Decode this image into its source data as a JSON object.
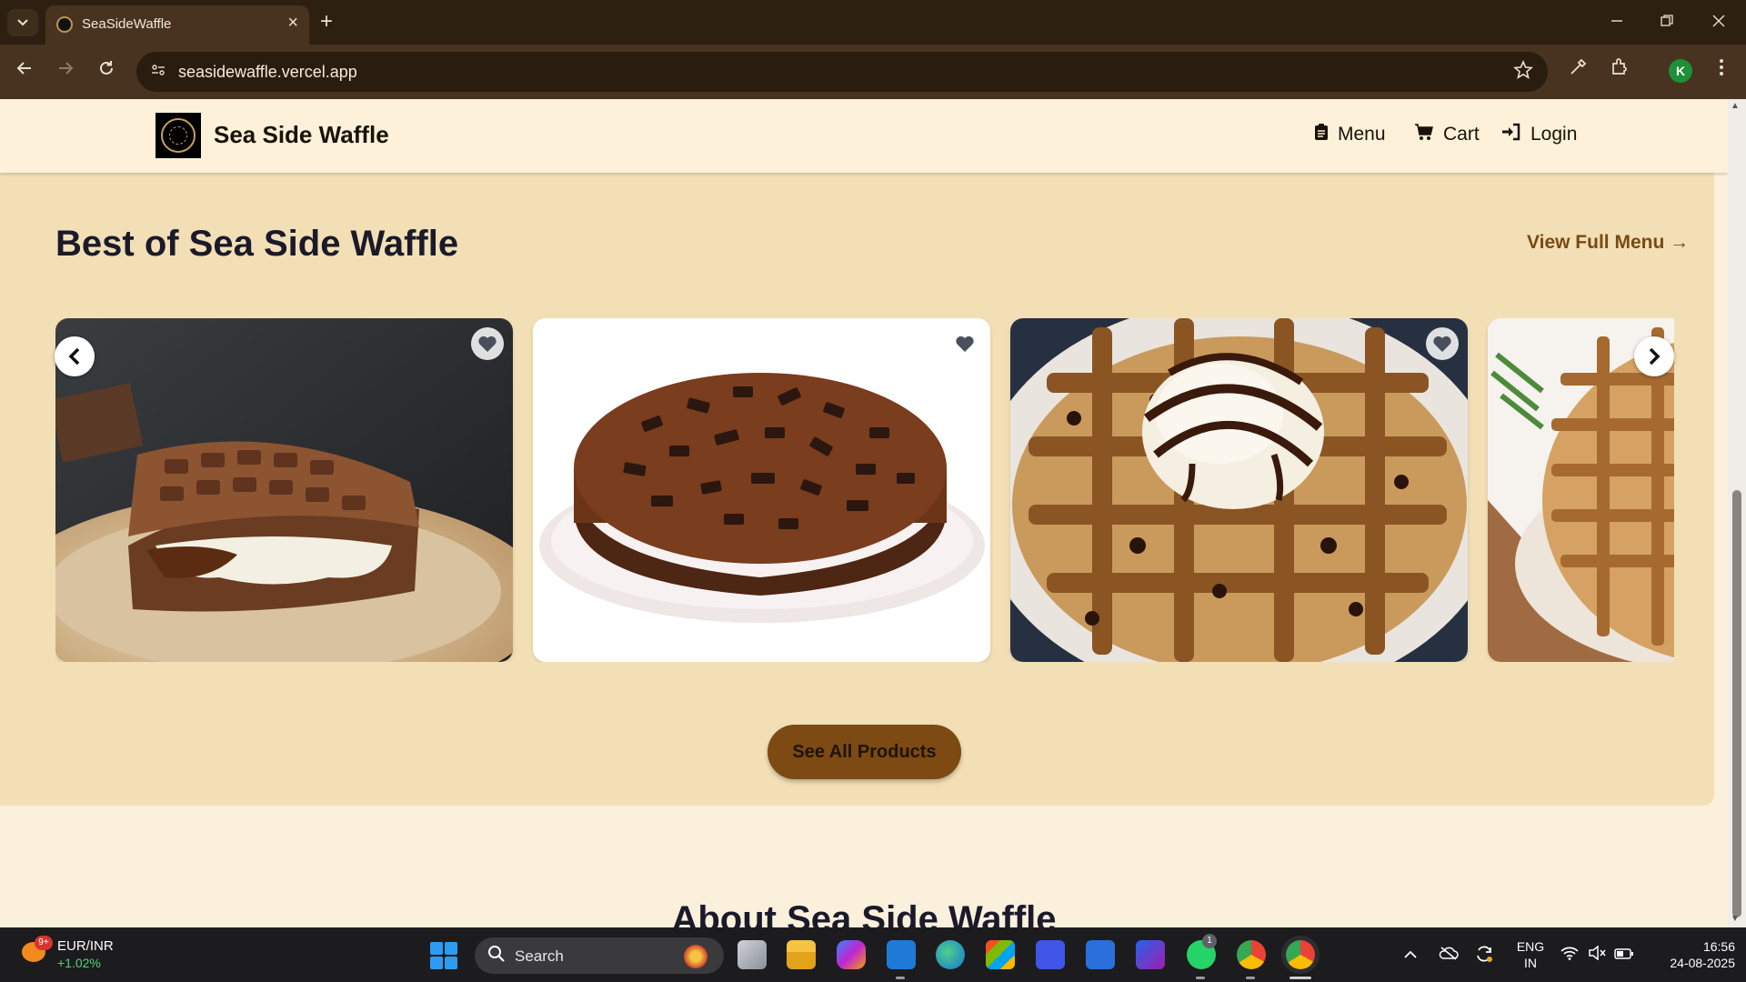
{
  "browser": {
    "tab_title": "SeaSideWaffle",
    "url": "seasidewaffle.vercel.app",
    "profile_initial": "K",
    "new_tab_symbol": "+",
    "tab_close_symbol": "×"
  },
  "header": {
    "brand": "Sea Side Waffle",
    "nav": [
      {
        "label": "Menu",
        "icon": "clipboard-icon"
      },
      {
        "label": "Cart",
        "icon": "cart-icon"
      },
      {
        "label": "Login",
        "icon": "login-icon"
      }
    ]
  },
  "best_section": {
    "title": "Best of Sea Side Waffle",
    "view_menu_link": "View Full Menu →",
    "cta": "See All Products",
    "products": [
      {
        "image": "chocolate-waffle-sandwich",
        "favorite": "heart-icon"
      },
      {
        "image": "oreo-chocolate-cake",
        "favorite": "heart-icon"
      },
      {
        "image": "ice-cream-waffle",
        "favorite": "heart-icon"
      },
      {
        "image": "stacked-waffles",
        "favorite": "heart-icon"
      }
    ]
  },
  "about": {
    "title": "About Sea Side Waffle"
  },
  "taskbar": {
    "ticker_name": "EUR/INR",
    "ticker_change": "+1.02%",
    "weather_badge": "9+",
    "search_placeholder": "Search",
    "whatsapp_badge": "1",
    "language": "ENG",
    "region": "IN",
    "time": "16:56",
    "date": "24-08-2025"
  },
  "colors": {
    "page_bg": "#fbf0dc",
    "section_bg": "#f2dfb6",
    "accent_brown": "#7c4a12",
    "link_brown": "#7a4a14",
    "heading": "#1a1a2a"
  }
}
